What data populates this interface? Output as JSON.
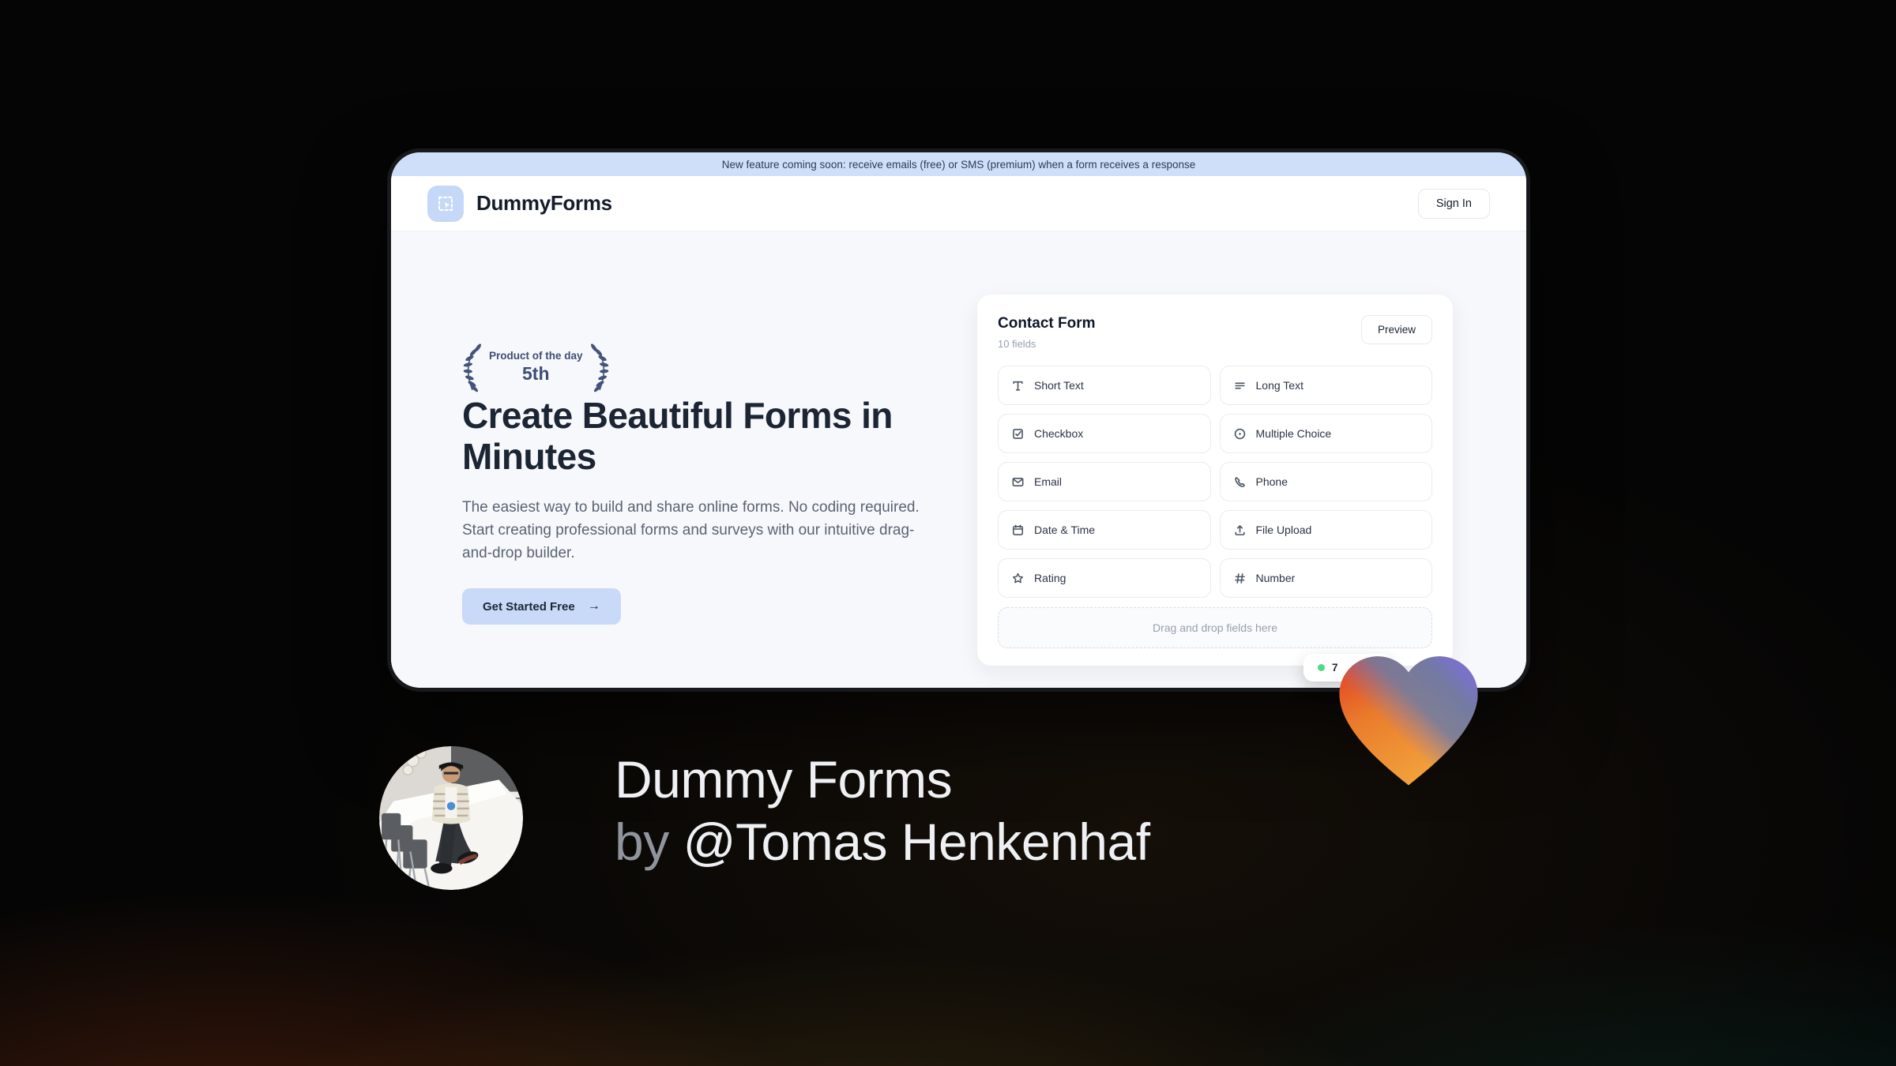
{
  "banner": {
    "text": "New feature coming soon: receive emails (free) or SMS (premium) when a form receives a response"
  },
  "header": {
    "brand": "DummyForms",
    "sign_in": "Sign In",
    "logo_icon": "dashed-select-cursor-icon"
  },
  "hero": {
    "badge_top": "Product of the day",
    "badge_rank": "5th",
    "title": "Create Beautiful Forms in Minutes",
    "description": "The easiest way to build and share online forms. No coding required. Start creating professional forms and surveys with our intuitive drag-and-drop builder.",
    "cta": "Get Started Free",
    "cta_icon": "arrow-right-icon"
  },
  "form_card": {
    "title": "Contact Form",
    "subtitle": "10 fields",
    "preview_label": "Preview",
    "fields": [
      {
        "label": "Short Text",
        "icon": "short-text-icon"
      },
      {
        "label": "Long Text",
        "icon": "long-text-icon"
      },
      {
        "label": "Checkbox",
        "icon": "checkbox-icon"
      },
      {
        "label": "Multiple Choice",
        "icon": "radio-circle-icon"
      },
      {
        "label": "Email",
        "icon": "envelope-icon"
      },
      {
        "label": "Phone",
        "icon": "phone-icon"
      },
      {
        "label": "Date & Time",
        "icon": "calendar-icon"
      },
      {
        "label": "File Upload",
        "icon": "upload-icon"
      },
      {
        "label": "Rating",
        "icon": "star-icon"
      },
      {
        "label": "Number",
        "icon": "hash-icon"
      }
    ],
    "dropzone_text": "Drag and drop fields here",
    "responses_badge": "7"
  },
  "footer": {
    "title": "Dummy Forms",
    "byline_prefix": "by",
    "handle": "@Tomas Henkenhaf"
  },
  "colors": {
    "banner_bg": "#cfdffa",
    "primary_button_bg": "#c8daf8",
    "navy_text": "#1c2534",
    "muted_text": "#5a6374",
    "green_dot": "#4ade80",
    "heart_warm": [
      "#e03a25",
      "#ea7c2c",
      "#f2a33c"
    ],
    "heart_cool": [
      "#6d7aa8",
      "#7b6fd8"
    ]
  }
}
